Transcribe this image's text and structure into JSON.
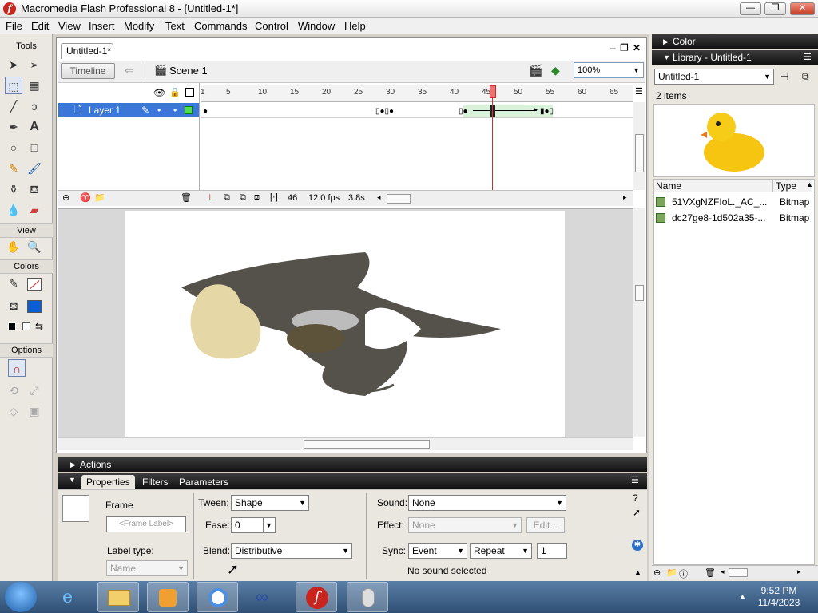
{
  "window": {
    "title": "Macromedia Flash Professional 8 - [Untitled-1*]",
    "controls": {
      "minimize": "—",
      "maximize": "❐",
      "close": "✕"
    }
  },
  "menu": [
    "File",
    "Edit",
    "View",
    "Insert",
    "Modify",
    "Text",
    "Commands",
    "Control",
    "Window",
    "Help"
  ],
  "toolbar": {
    "tools_label": "Tools",
    "view_label": "View",
    "colors_label": "Colors",
    "options_label": "Options"
  },
  "document": {
    "tab": "Untitled-1*",
    "timeline_button": "Timeline",
    "scene": "Scene 1",
    "zoom": "100%"
  },
  "timeline": {
    "layer_name": "Layer 1",
    "ticks": [
      "1",
      "5",
      "10",
      "15",
      "20",
      "25",
      "30",
      "35",
      "40",
      "45",
      "50",
      "55",
      "60",
      "65"
    ],
    "current_frame": "46",
    "frame_rate": "12.0 fps",
    "elapsed": "3.8s"
  },
  "actions_panel": {
    "label": "Actions"
  },
  "properties": {
    "tabs": [
      "Properties",
      "Filters",
      "Parameters"
    ],
    "frame_heading": "Frame",
    "frame_label_placeholder": "<Frame Label>",
    "label_type_label": "Label type:",
    "label_type_value": "Name",
    "tween_label": "Tween:",
    "tween_value": "Shape",
    "ease_label": "Ease:",
    "ease_value": "0",
    "blend_label": "Blend:",
    "blend_value": "Distributive",
    "sound_label": "Sound:",
    "sound_value": "None",
    "effect_label": "Effect:",
    "effect_value": "None",
    "edit_button": "Edit...",
    "sync_label": "Sync:",
    "sync_value": "Event",
    "repeat_value": "Repeat",
    "repeat_count": "1",
    "sound_status": "No sound selected"
  },
  "panels": {
    "color_title": "Color",
    "library_title": "Library - Untitled-1",
    "library_doc": "Untitled-1",
    "item_count": "2 items",
    "columns": [
      "Name",
      "Type"
    ],
    "items": [
      {
        "name": "51VXgNZFIoL._AC_...",
        "type": "Bitmap"
      },
      {
        "name": "dc27ge8-1d502a35-...",
        "type": "Bitmap"
      }
    ]
  },
  "taskbar": {
    "time": "9:52 PM",
    "date": "11/4/2023"
  },
  "colors": {
    "layer_highlight": "#3a77d8",
    "panel_header": "#1e1e1e",
    "playhead": "#d03030",
    "tween_fill": "#d9f2d9"
  }
}
